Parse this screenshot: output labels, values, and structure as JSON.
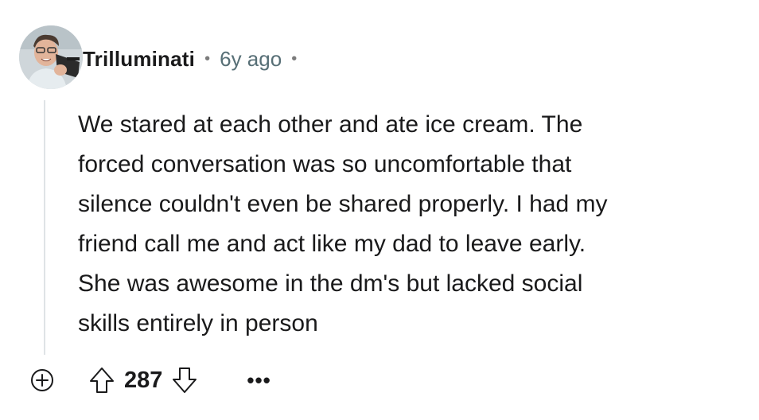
{
  "comment": {
    "author": "Trilluminati",
    "separator_1": "•",
    "age": "6y ago",
    "separator_2": "•",
    "body": "We stared at each other and ate ice cream. The\nforced conversation was so uncomfortable that\nsilence couldn't even be shared properly. I had my\nfriend call me and act like my dad to leave early.\nShe was awesome in the dm's but lacked social\nskills entirely in person",
    "score": "287",
    "more_label": "•••"
  },
  "icons": {
    "expand": "plus-circle-icon",
    "upvote": "arrow-up-icon",
    "downvote": "arrow-down-icon",
    "more": "overflow-menu-icon"
  },
  "colors": {
    "text": "#1a1a1b",
    "meta": "#576f76",
    "thread_line": "#dfe3e6"
  }
}
